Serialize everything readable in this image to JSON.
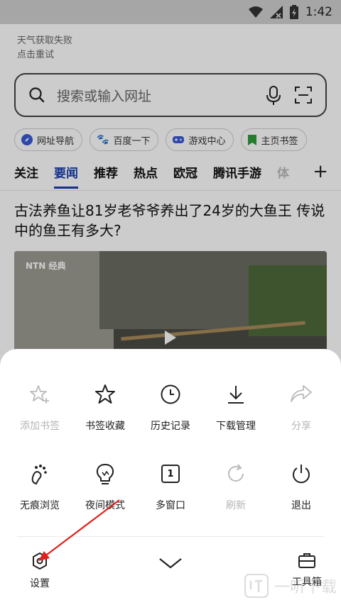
{
  "status_bar": {
    "time": "1:42"
  },
  "weather": {
    "line1": "天气获取失败",
    "line2": "点击重试"
  },
  "search": {
    "placeholder": "搜索或输入网址"
  },
  "quick_links": [
    {
      "label": "网址导航",
      "color": "#3a59d6"
    },
    {
      "label": "百度一下",
      "color": "#3a59d6"
    },
    {
      "label": "游戏中心",
      "color": "#3a59d6"
    },
    {
      "label": "主页书签",
      "color": "#2f9a3a"
    }
  ],
  "channel_tabs": [
    "关注",
    "要闻",
    "推荐",
    "热点",
    "欧冠",
    "腾讯手游",
    "体"
  ],
  "active_tab": "要闻",
  "article": {
    "title": "古法养鱼让81岁老爷爷养出了24岁的大鱼王 传说中的鱼王有多大?",
    "video_logo": "NTN 经典"
  },
  "menu": {
    "row1": [
      {
        "label": "添加书签",
        "icon": "star-plus-icon",
        "enabled": false
      },
      {
        "label": "书签收藏",
        "icon": "star-icon",
        "enabled": true
      },
      {
        "label": "历史记录",
        "icon": "clock-icon",
        "enabled": true
      },
      {
        "label": "下载管理",
        "icon": "download-icon",
        "enabled": true
      },
      {
        "label": "分享",
        "icon": "share-icon",
        "enabled": false
      }
    ],
    "row2": [
      {
        "label": "无痕浏览",
        "icon": "footprint-icon",
        "enabled": true
      },
      {
        "label": "夜间模式",
        "icon": "bulb-icon",
        "enabled": true
      },
      {
        "label": "多窗口",
        "icon": "window-count-icon",
        "enabled": true,
        "count": "1"
      },
      {
        "label": "刷新",
        "icon": "refresh-icon",
        "enabled": false
      },
      {
        "label": "退出",
        "icon": "power-icon",
        "enabled": true
      }
    ]
  },
  "bottom_bar": {
    "settings_label": "设置",
    "toolbox_label": "工具箱"
  },
  "watermark": {
    "text": "一听下载"
  },
  "colors": {
    "accent": "#1a3fb0",
    "annotation": "#e0201c"
  }
}
